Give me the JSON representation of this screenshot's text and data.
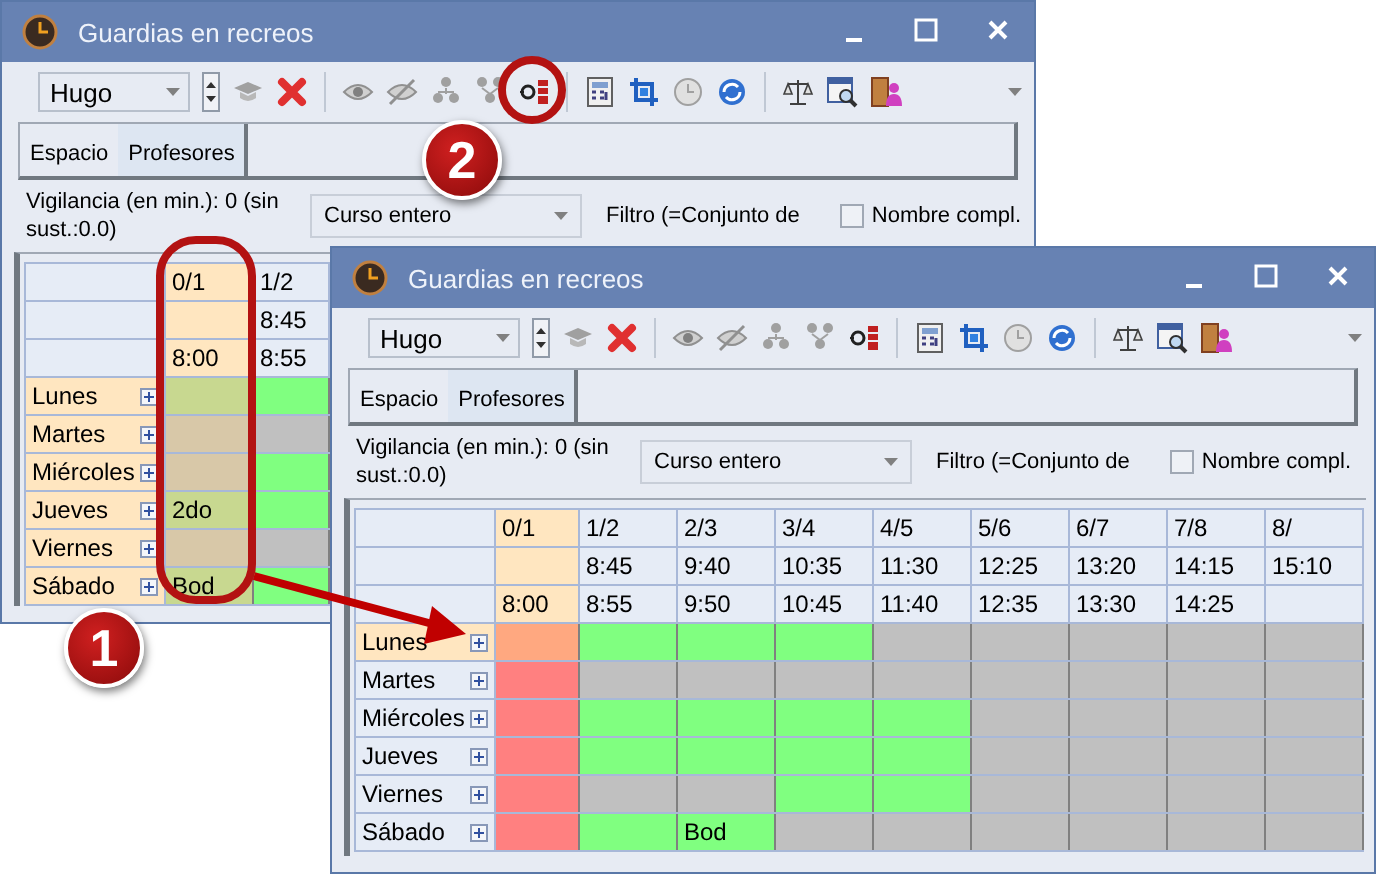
{
  "windows": [
    {
      "title": "Guardias en recreos",
      "teacher": "Hugo",
      "tabs": [
        {
          "label": "Espacio",
          "selected": false
        },
        {
          "label": "Profesores",
          "selected": true
        }
      ],
      "vigilance": "Vigilancia (en min.): 0 (sin sust.:0.0)",
      "period_select": "Curso entero",
      "filter": "Filtro (=Conjunto de",
      "full_name": {
        "label": "Nombre compl.",
        "checked": false
      },
      "grid": {
        "columns": [
          {
            "period": "0/1",
            "end": "8:00",
            "selected": true
          },
          {
            "period": "1/2",
            "start": "8:45",
            "end": "8:55",
            "selected": false
          }
        ],
        "rows": [
          {
            "day": "Lunes",
            "selected": true,
            "cells": [
              {
                "color": "#c8d890"
              },
              {
                "color": "#80ff80"
              }
            ]
          },
          {
            "day": "Martes",
            "selected": true,
            "cells": [
              {
                "color": "#d8c8a8"
              },
              {
                "color": "#c0c0c0"
              }
            ]
          },
          {
            "day": "Miércoles",
            "selected": true,
            "cells": [
              {
                "color": "#d8c8a8"
              },
              {
                "color": "#80ff80"
              }
            ]
          },
          {
            "day": "Jueves",
            "selected": true,
            "cells": [
              {
                "color": "#c8d890",
                "text": "2do"
              },
              {
                "color": "#80ff80"
              }
            ]
          },
          {
            "day": "Viernes",
            "selected": true,
            "cells": [
              {
                "color": "#d8c8a8"
              },
              {
                "color": "#c0c0c0"
              }
            ]
          },
          {
            "day": "Sábado",
            "selected": true,
            "cells": [
              {
                "color": "#c8d890",
                "text": "Bod"
              },
              {
                "color": "#80ff80"
              }
            ]
          }
        ]
      }
    },
    {
      "title": "Guardias en recreos",
      "teacher": "Hugo",
      "tabs": [
        {
          "label": "Espacio",
          "selected": false
        },
        {
          "label": "Profesores",
          "selected": true
        }
      ],
      "vigilance": "Vigilancia (en min.): 0 (sin sust.:0.0)",
      "period_select": "Curso entero",
      "filter": "Filtro (=Conjunto de",
      "full_name": {
        "label": "Nombre compl.",
        "checked": false
      },
      "grid": {
        "columns": [
          {
            "period": "0/1",
            "end": "8:00",
            "selected": true
          },
          {
            "period": "1/2",
            "start": "8:45",
            "end": "8:55",
            "selected": false
          },
          {
            "period": "2/3",
            "start": "9:40",
            "end": "9:50",
            "selected": false
          },
          {
            "period": "3/4",
            "start": "10:35",
            "end": "10:45",
            "selected": false
          },
          {
            "period": "4/5",
            "start": "11:30",
            "end": "11:40",
            "selected": false
          },
          {
            "period": "5/6",
            "start": "12:25",
            "end": "12:35",
            "selected": false
          },
          {
            "period": "6/7",
            "start": "13:20",
            "end": "13:30",
            "selected": false
          },
          {
            "period": "7/8",
            "start": "14:15",
            "end": "14:25",
            "selected": false
          },
          {
            "period": "8/",
            "start": "15:10",
            "selected": false
          }
        ],
        "rows": [
          {
            "day": "Lunes",
            "selected": true,
            "cells": [
              {
                "color": "#ffa880"
              },
              {
                "color": "#80ff80"
              },
              {
                "color": "#80ff80"
              },
              {
                "color": "#80ff80"
              },
              {
                "color": "#c0c0c0"
              },
              {
                "color": "#c0c0c0"
              },
              {
                "color": "#c0c0c0"
              },
              {
                "color": "#c0c0c0"
              },
              {
                "color": "#c0c0c0"
              }
            ]
          },
          {
            "day": "Martes",
            "selected": false,
            "cells": [
              {
                "color": "#ff8080"
              },
              {
                "color": "#c0c0c0"
              },
              {
                "color": "#c0c0c0"
              },
              {
                "color": "#c0c0c0"
              },
              {
                "color": "#c0c0c0"
              },
              {
                "color": "#c0c0c0"
              },
              {
                "color": "#c0c0c0"
              },
              {
                "color": "#c0c0c0"
              },
              {
                "color": "#c0c0c0"
              }
            ]
          },
          {
            "day": "Miércoles",
            "selected": false,
            "cells": [
              {
                "color": "#ff8080"
              },
              {
                "color": "#80ff80"
              },
              {
                "color": "#80ff80"
              },
              {
                "color": "#80ff80"
              },
              {
                "color": "#80ff80"
              },
              {
                "color": "#c0c0c0"
              },
              {
                "color": "#c0c0c0"
              },
              {
                "color": "#c0c0c0"
              },
              {
                "color": "#c0c0c0"
              }
            ]
          },
          {
            "day": "Jueves",
            "selected": false,
            "cells": [
              {
                "color": "#ff8080"
              },
              {
                "color": "#80ff80"
              },
              {
                "color": "#80ff80"
              },
              {
                "color": "#80ff80"
              },
              {
                "color": "#80ff80"
              },
              {
                "color": "#c0c0c0"
              },
              {
                "color": "#c0c0c0"
              },
              {
                "color": "#c0c0c0"
              },
              {
                "color": "#c0c0c0"
              }
            ]
          },
          {
            "day": "Viernes",
            "selected": false,
            "cells": [
              {
                "color": "#ff8080"
              },
              {
                "color": "#c0c0c0"
              },
              {
                "color": "#c0c0c0"
              },
              {
                "color": "#80ff80"
              },
              {
                "color": "#80ff80"
              },
              {
                "color": "#c0c0c0"
              },
              {
                "color": "#c0c0c0"
              },
              {
                "color": "#c0c0c0"
              },
              {
                "color": "#c0c0c0"
              }
            ]
          },
          {
            "day": "Sábado",
            "selected": false,
            "cells": [
              {
                "color": "#ff8080"
              },
              {
                "color": "#80ff80"
              },
              {
                "color": "#80ff80",
                "text": "Bod"
              },
              {
                "color": "#c0c0c0"
              },
              {
                "color": "#c0c0c0"
              },
              {
                "color": "#c0c0c0"
              },
              {
                "color": "#c0c0c0"
              },
              {
                "color": "#c0c0c0"
              },
              {
                "color": "#c0c0c0"
              }
            ]
          }
        ]
      }
    }
  ],
  "callouts": [
    {
      "number": "1"
    },
    {
      "number": "2"
    }
  ]
}
